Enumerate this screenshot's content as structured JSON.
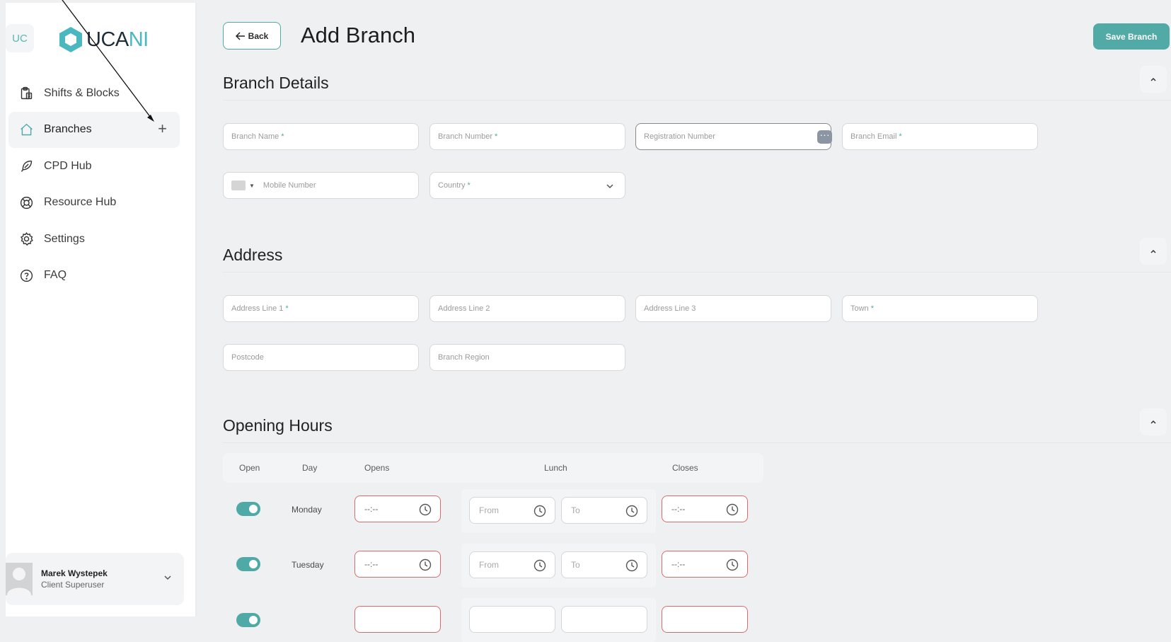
{
  "sidebar": {
    "badge": "UC",
    "logo": {
      "part1": "UCA",
      "part2": "NI"
    },
    "items": [
      {
        "label": "Shifts & Blocks",
        "icon": "clipboard-icon",
        "active": false
      },
      {
        "label": "Branches",
        "icon": "home-icon",
        "active": true,
        "action": "+"
      },
      {
        "label": "CPD Hub",
        "icon": "feather-icon",
        "active": false
      },
      {
        "label": "Resource Hub",
        "icon": "lifebuoy-icon",
        "active": false
      },
      {
        "label": "Settings",
        "icon": "gear-icon",
        "active": false
      },
      {
        "label": "FAQ",
        "icon": "question-circle-icon",
        "active": false
      }
    ],
    "user": {
      "name": "Marek Wystepek",
      "role": "Client Superuser"
    }
  },
  "header": {
    "back_label": "Back",
    "title": "Add Branch",
    "save_label": "Save Branch"
  },
  "branch_details": {
    "title": "Branch Details",
    "fields": {
      "branch_name": {
        "placeholder": "Branch Name",
        "required": "*"
      },
      "branch_number": {
        "placeholder": "Branch Number",
        "required": "*"
      },
      "registration_number": {
        "placeholder": "Registration Number"
      },
      "branch_email": {
        "placeholder": "Branch Email",
        "required": "*"
      },
      "mobile_number": {
        "placeholder": "Mobile Number"
      },
      "country": {
        "placeholder": "Country",
        "required": "*"
      }
    }
  },
  "address": {
    "title": "Address",
    "fields": {
      "line1": {
        "placeholder": "Address Line 1",
        "required": "*"
      },
      "line2": {
        "placeholder": "Address Line 2"
      },
      "line3": {
        "placeholder": "Address Line 3"
      },
      "town": {
        "placeholder": "Town",
        "required": "*"
      },
      "postcode": {
        "placeholder": "Postcode"
      },
      "region": {
        "placeholder": "Branch Region"
      }
    }
  },
  "opening_hours": {
    "title": "Opening Hours",
    "columns": {
      "open": "Open",
      "day": "Day",
      "opens": "Opens",
      "lunch": "Lunch",
      "closes": "Closes"
    },
    "rows": [
      {
        "day": "Monday",
        "open": true,
        "opens": "--:--",
        "lunch_from": "From",
        "lunch_to": "To",
        "closes": "--:--"
      },
      {
        "day": "Tuesday",
        "open": true,
        "opens": "--:--",
        "lunch_from": "From",
        "lunch_to": "To",
        "closes": "--:--"
      }
    ]
  },
  "colors": {
    "accent": "#52aaa6",
    "error": "#d96b6b",
    "logo_teal": "#4bb8c0"
  }
}
